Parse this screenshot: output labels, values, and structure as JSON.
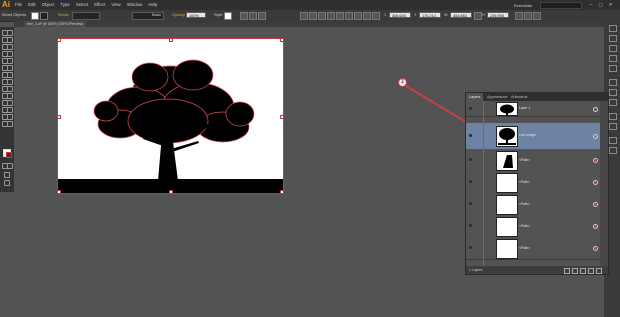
{
  "app": {
    "logo": "Ai",
    "menus": [
      "File",
      "Edit",
      "Object",
      "Type",
      "Select",
      "Effect",
      "View",
      "Window",
      "Help"
    ],
    "workspace": "Essentials",
    "window_controls": [
      "–",
      "▢",
      "✕"
    ]
  },
  "control_bar": {
    "selection_label": "Mixed Objects",
    "stroke_label": "Stroke",
    "stroke_weight": "",
    "brush_label": "Basic",
    "opacity_label": "Opacity",
    "opacity_value": "100%",
    "style_label": "Style",
    "x_label": "X",
    "x_value": "306.645 mm",
    "y_label": "Y",
    "y_value": "176.213 mm",
    "w_label": "W",
    "w_value": "453.683 mm",
    "h_label": "H",
    "h_value": "239.998 mm"
  },
  "document": {
    "tab_label": "tree_1.ai* @ 100% (CMYK/Preview)"
  },
  "callout": {
    "number": "1"
  },
  "layers_panel": {
    "tabs": [
      "Layers",
      "Appearance",
      "Artboards"
    ],
    "active_tab": "Layers",
    "rows": [
      {
        "label": "Layer 1",
        "type": "layer",
        "thumb": "tree-icon",
        "selected": false
      },
      {
        "label": "Live Image",
        "type": "group",
        "thumb": "tree-icon",
        "selected": true
      },
      {
        "label": "<Path>",
        "type": "path",
        "thumb": "shape-icon",
        "selected": false
      },
      {
        "label": "<Path>",
        "type": "path",
        "thumb": "blank",
        "selected": false
      },
      {
        "label": "<Path>",
        "type": "path",
        "thumb": "blank",
        "selected": false
      },
      {
        "label": "<Path>",
        "type": "path",
        "thumb": "blank",
        "selected": false
      },
      {
        "label": "<Path>",
        "type": "path",
        "thumb": "blank",
        "selected": false
      }
    ],
    "footer": "1 Layers",
    "selection_color": "#6e82a3",
    "accent_color": "#e03a3a"
  },
  "colors": {
    "callout": "#d23e48",
    "brand": "#f39a1e"
  }
}
